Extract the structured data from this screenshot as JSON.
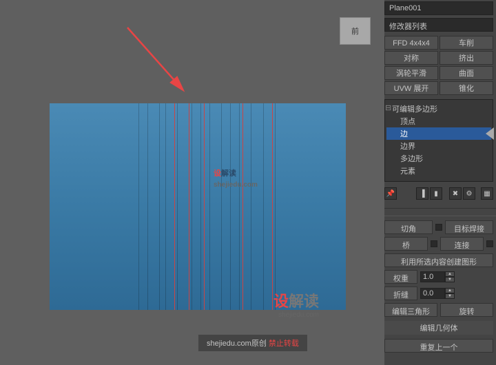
{
  "object_name": "Plane001",
  "modifier_dropdown": "修改器列表",
  "mod_buttons": [
    {
      "label": "FFD 4x4x4"
    },
    {
      "label": "车削"
    },
    {
      "label": "对称"
    },
    {
      "label": "挤出"
    },
    {
      "label": "涡轮平滑"
    },
    {
      "label": "曲面"
    },
    {
      "label": "UVW 展开"
    },
    {
      "label": "锥化"
    }
  ],
  "tree": {
    "root": "可编辑多边形",
    "items": [
      "顶点",
      "边",
      "边界",
      "多边形",
      "元素"
    ],
    "selected": "边"
  },
  "edit_edges": {
    "chamfer": "切角",
    "target_weld": "目标焊接",
    "bridge": "桥",
    "connect": "连接",
    "create_shape": "利用所选内容创建图形",
    "weight": "权重",
    "weight_val": "1.0",
    "crease": "折缝",
    "crease_val": "0.0",
    "edit_tri": "编辑三角形",
    "turn": "旋转"
  },
  "geom_header": "编辑几何体",
  "geom": {
    "repeat": "重复上一个"
  },
  "watermark": {
    "red": "设",
    "rest": "解读",
    "sub": "shejiedu.com"
  },
  "footer": {
    "a": "shejiedu.com原创 ",
    "b": "禁止转载"
  }
}
